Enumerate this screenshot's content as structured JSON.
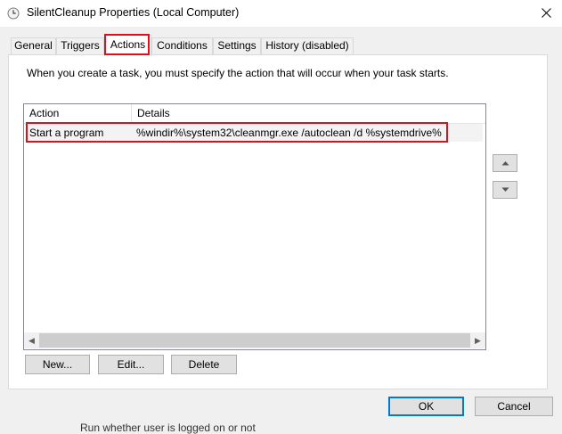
{
  "window": {
    "title": "SilentCleanup Properties (Local Computer)",
    "close_icon": "close-icon"
  },
  "tabs": [
    {
      "label": "General",
      "active": false
    },
    {
      "label": "Triggers",
      "active": false
    },
    {
      "label": "Actions",
      "active": true
    },
    {
      "label": "Conditions",
      "active": false
    },
    {
      "label": "Settings",
      "active": false
    },
    {
      "label": "History (disabled)",
      "active": false
    }
  ],
  "actions_panel": {
    "description": "When you create a task, you must specify the action that will occur when your task starts.",
    "columns": [
      "Action",
      "Details"
    ],
    "rows": [
      {
        "action": "Start a program",
        "details": "%windir%\\system32\\cleanmgr.exe /autoclean /d %systemdrive%"
      }
    ],
    "buttons": {
      "new": "New...",
      "edit": "Edit...",
      "delete": "Delete"
    }
  },
  "dialog_buttons": {
    "ok": "OK",
    "cancel": "Cancel"
  },
  "background_text": "Run whether user is logged on or not",
  "colors": {
    "highlight": "#e0101a",
    "ok_border": "#0078d7"
  }
}
